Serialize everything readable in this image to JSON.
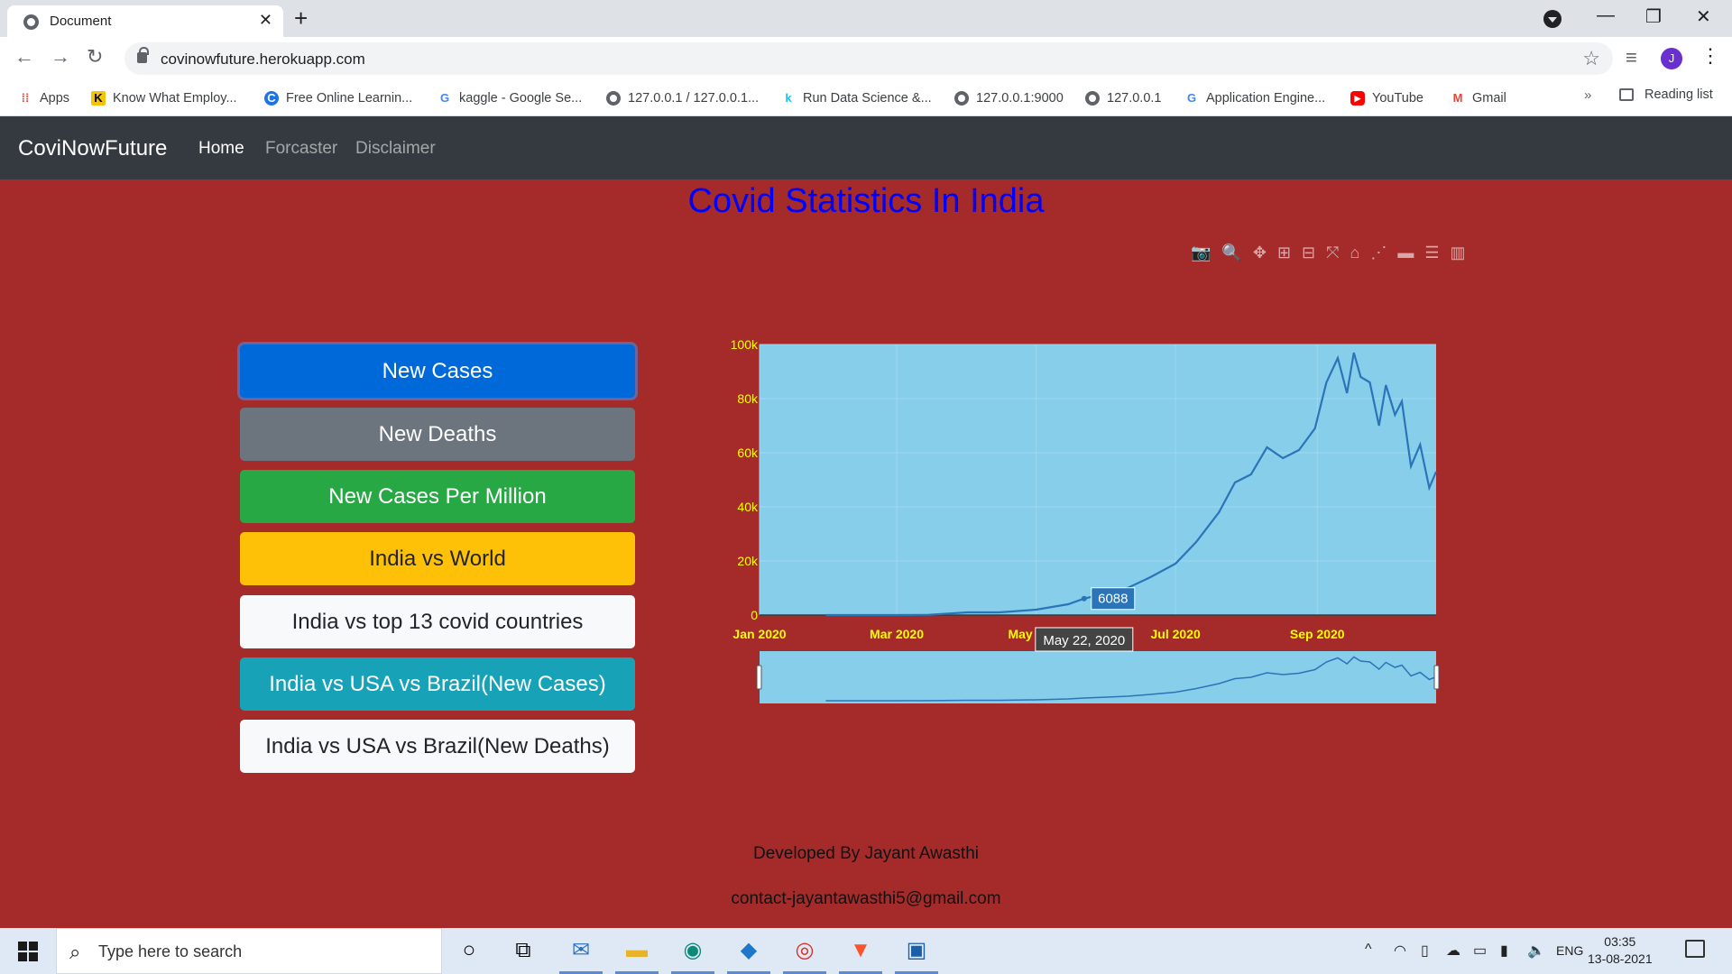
{
  "browser": {
    "tab_title": "Document",
    "url": "covinowfuture.herokuapp.com",
    "avatar_letter": "J",
    "bookmarks": [
      {
        "label": "Apps",
        "icon": "apps-icon"
      },
      {
        "label": "Know What Employ...",
        "icon": "k-logo-icon"
      },
      {
        "label": "Free Online Learnin...",
        "icon": "c-logo-icon"
      },
      {
        "label": "kaggle - Google Se...",
        "icon": "google-icon"
      },
      {
        "label": "127.0.0.1 / 127.0.0.1...",
        "icon": "globe-icon"
      },
      {
        "label": "Run Data Science &...",
        "icon": "k-kaggle-icon"
      },
      {
        "label": "127.0.0.1:9000",
        "icon": "globe-icon"
      },
      {
        "label": "127.0.0.1",
        "icon": "globe-icon"
      },
      {
        "label": "Application Engine...",
        "icon": "google-icon"
      },
      {
        "label": "YouTube",
        "icon": "youtube-icon"
      },
      {
        "label": "Gmail",
        "icon": "gmail-icon"
      }
    ],
    "bookmarks_more": "»",
    "reading_list": "Reading list"
  },
  "site": {
    "brand": "CoviNowFuture",
    "nav": [
      "Home",
      "Forcaster",
      "Disclaimer"
    ],
    "heading": "Covid Statistics In India",
    "buttons": [
      "New Cases",
      "New Deaths",
      "New Cases Per Million",
      "India vs World",
      "India vs top 13 covid countries",
      "India vs USA vs Brazil(New Cases)",
      "India vs USA vs Brazil(New Deaths)"
    ],
    "footer_dev": "Developed By Jayant Awasthi",
    "footer_contact": "contact-jayantawasthi5@gmail.com"
  },
  "chart_data": {
    "type": "line",
    "title": "",
    "xlabel": "",
    "ylabel": "",
    "xlim": [
      "2020-01-01",
      "2020-10-23"
    ],
    "ylim": [
      0,
      100000
    ],
    "x_ticks": [
      "Jan 2020",
      "Mar 2020",
      "May 2020",
      "Jul 2020",
      "Sep 2020"
    ],
    "y_ticks": [
      "0",
      "20k",
      "40k",
      "60k",
      "80k",
      "100k"
    ],
    "grid": true,
    "range_slider": true,
    "hover": {
      "x_label": "May 22, 2020",
      "y_label": "6088",
      "x": "2020-05-22",
      "y": 6088
    },
    "series": [
      {
        "x": [
          "2020-01-30",
          "2020-03-01",
          "2020-03-15",
          "2020-04-01",
          "2020-04-15",
          "2020-05-01",
          "2020-05-15",
          "2020-05-22",
          "2020-06-01",
          "2020-06-10",
          "2020-06-20",
          "2020-07-01",
          "2020-07-10",
          "2020-07-20",
          "2020-07-27",
          "2020-08-03",
          "2020-08-10",
          "2020-08-17",
          "2020-08-24",
          "2020-08-31",
          "2020-09-05",
          "2020-09-10",
          "2020-09-14",
          "2020-09-17",
          "2020-09-20",
          "2020-09-24",
          "2020-09-28",
          "2020-10-01",
          "2020-10-05",
          "2020-10-08",
          "2020-10-12",
          "2020-10-16",
          "2020-10-20",
          "2020-10-23"
        ],
        "y": [
          0,
          5,
          100,
          1000,
          1000,
          2000,
          4000,
          6088,
          8000,
          10000,
          14000,
          19000,
          27000,
          38000,
          49000,
          52000,
          62000,
          58000,
          61000,
          69000,
          86000,
          95000,
          82000,
          97000,
          88000,
          86000,
          70000,
          85000,
          74000,
          79000,
          55000,
          63000,
          47000,
          53000
        ]
      }
    ],
    "colors": {
      "line": "#2b74b8",
      "plot_bg": "#87ceeb",
      "axis_text": "#ffff00"
    }
  },
  "taskbar": {
    "search_placeholder": "Type here to search",
    "lang": "ENG",
    "time": "03:35",
    "date": "13-08-2021"
  }
}
